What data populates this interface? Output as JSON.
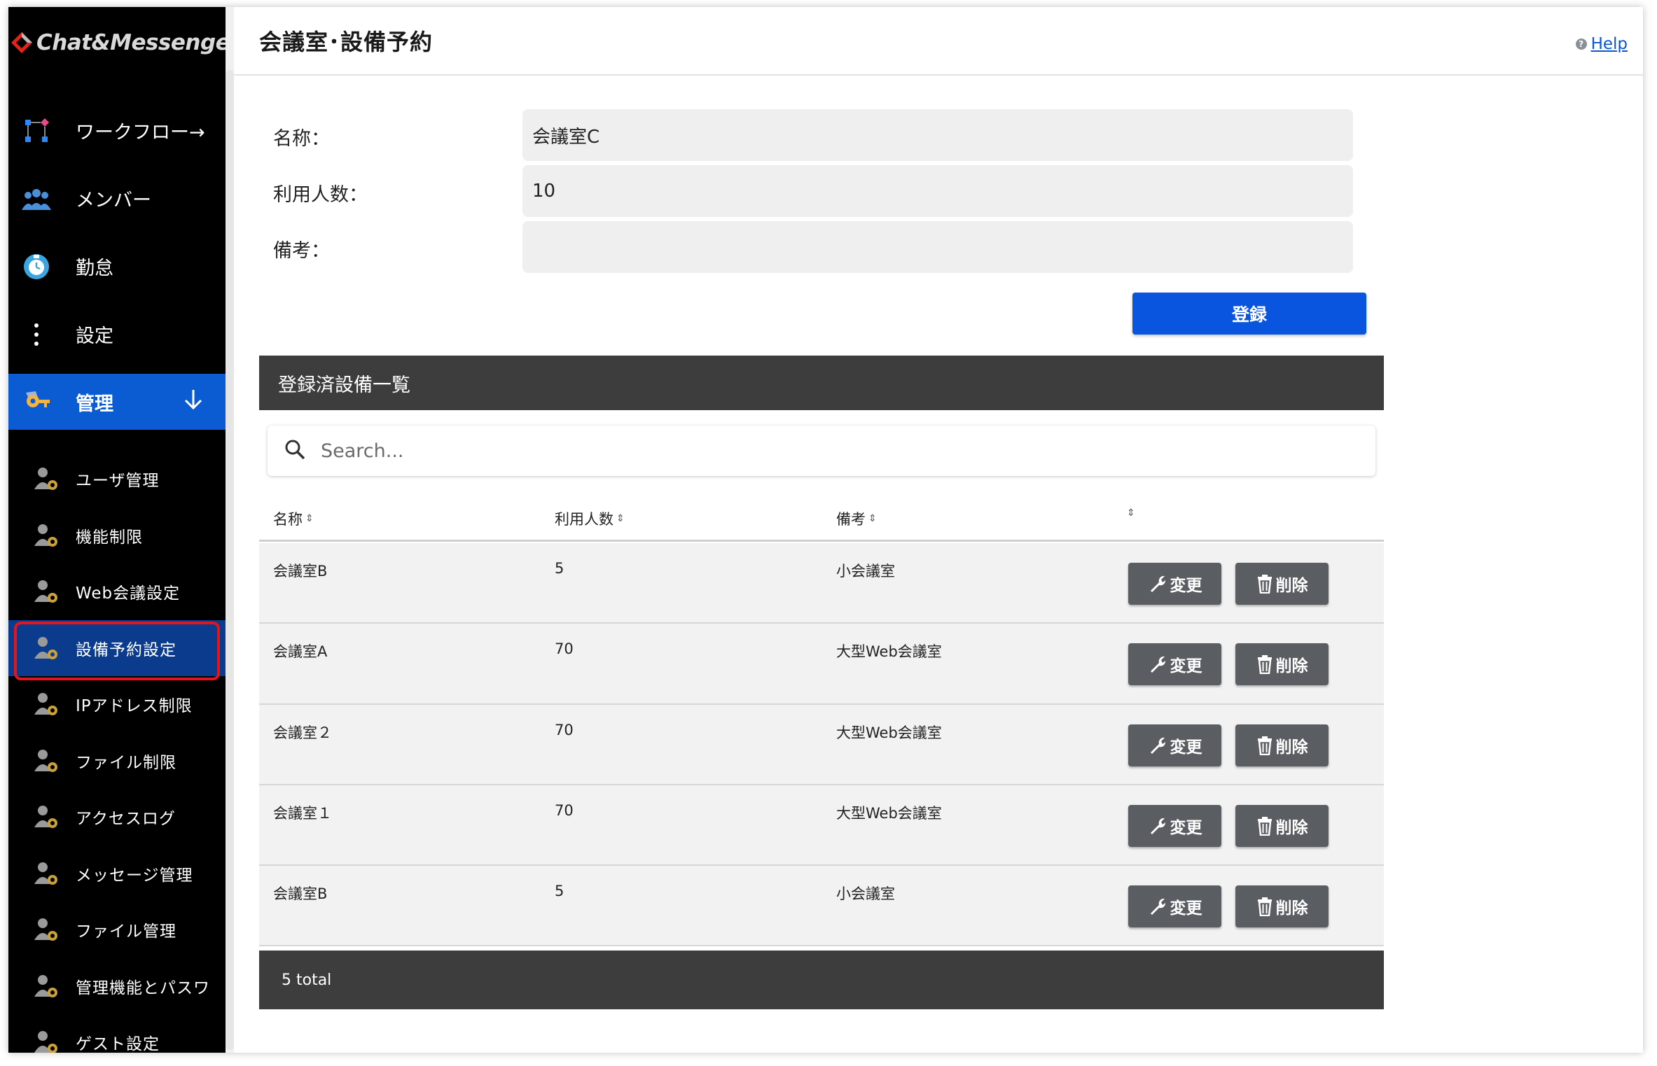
{
  "brand": {
    "name": "Chat&Messenger"
  },
  "sidebar": {
    "main_items": [
      {
        "label": "ワークフロー→",
        "icon": "workflow-icon"
      },
      {
        "label": "メンバー",
        "icon": "members-icon"
      },
      {
        "label": "勤怠",
        "icon": "clock-icon"
      },
      {
        "label": "設定",
        "icon": "more-vertical-icon"
      },
      {
        "label": "管理",
        "icon": "key-icon",
        "active": true
      }
    ],
    "sub_items": [
      {
        "label": "ユーザ管理"
      },
      {
        "label": "機能制限"
      },
      {
        "label": "Web会議設定"
      },
      {
        "label": "設備予約設定",
        "selected": true
      },
      {
        "label": "IPアドレス制限"
      },
      {
        "label": "ファイル制限"
      },
      {
        "label": "アクセスログ"
      },
      {
        "label": "メッセージ管理"
      },
      {
        "label": "ファイル管理"
      },
      {
        "label": "管理機能とパスワ"
      },
      {
        "label": "ゲスト設定"
      }
    ]
  },
  "header": {
    "title": "会議室･設備予約",
    "help_label": "Help"
  },
  "form": {
    "name_label": "名称：",
    "name_value": "会議室C",
    "capacity_label": "利用人数：",
    "capacity_value": "10",
    "note_label": "備考：",
    "note_value": "",
    "submit_label": "登録"
  },
  "list": {
    "title": "登録済設備一覧",
    "search_placeholder": "Search...",
    "columns": [
      "名称",
      "利用人数",
      "備考",
      ""
    ],
    "edit_label": "変更",
    "delete_label": "削除",
    "rows": [
      {
        "name": "会議室B",
        "capacity": "5",
        "note": "小会議室"
      },
      {
        "name": "会議室A",
        "capacity": "70",
        "note": "大型Web会議室"
      },
      {
        "name": "会議室２",
        "capacity": "70",
        "note": "大型Web会議室"
      },
      {
        "name": "会議室１",
        "capacity": "70",
        "note": "大型Web会議室"
      },
      {
        "name": "会議室B",
        "capacity": "5",
        "note": "小会議室"
      }
    ],
    "footer": "5 total"
  },
  "colors": {
    "primary": "#0a55e0",
    "sidebar_bg": "#000000",
    "active_nav": "#0b5bd3",
    "highlight_border": "#e3141b",
    "header_bar": "#3d3d3d"
  }
}
